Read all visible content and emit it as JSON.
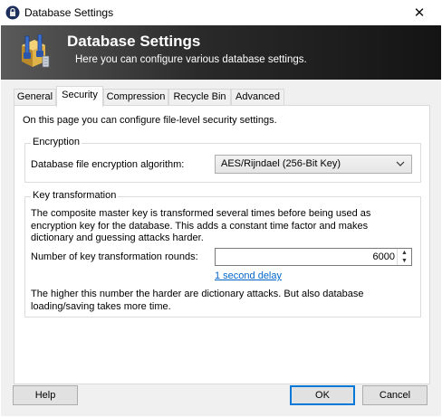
{
  "window": {
    "title": "Database Settings",
    "close_glyph": "✕",
    "icon": "lock-icon"
  },
  "banner": {
    "title": "Database Settings",
    "subtitle": "Here you can configure various database settings.",
    "icon": "database-settings-icon"
  },
  "tabs": [
    {
      "label": "General"
    },
    {
      "label": "Security"
    },
    {
      "label": "Compression"
    },
    {
      "label": "Recycle Bin"
    },
    {
      "label": "Advanced"
    }
  ],
  "active_tab": "Security",
  "security": {
    "intro": "On this page you can configure file-level security settings.",
    "encryption": {
      "legend": "Encryption",
      "algorithm_label": "Database file encryption algorithm:",
      "algorithm_value": "AES/Rijndael (256-Bit Key)"
    },
    "key_transformation": {
      "legend": "Key transformation",
      "description": "The composite master key is transformed several times before being used as encryption key for the database. This adds a constant time factor and makes dictionary and guessing attacks harder.",
      "rounds_label": "Number of key transformation rounds:",
      "rounds_value": "6000",
      "delay_link": "1 second delay",
      "note": "The higher this number the harder are dictionary attacks. But also database loading/saving takes more time."
    }
  },
  "buttons": {
    "help": "Help",
    "ok": "OK",
    "cancel": "Cancel"
  }
}
